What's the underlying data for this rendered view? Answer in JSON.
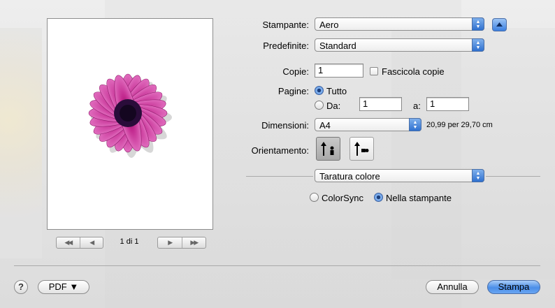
{
  "preview": {
    "page_info": "1 di 1",
    "nav_first": "◀◀",
    "nav_prev": "◀",
    "nav_next": "▶",
    "nav_last": "▶▶"
  },
  "printer": {
    "label": "Stampante:",
    "value": "Aero"
  },
  "presets": {
    "label": "Predefinite:",
    "value": "Standard"
  },
  "copies": {
    "label": "Copie:",
    "value": "1",
    "collate_label": "Fascicola copie"
  },
  "pages": {
    "label": "Pagine:",
    "all_label": "Tutto",
    "from_label": "Da:",
    "from_value": "1",
    "to_label": "a:",
    "to_value": "1"
  },
  "paper_size": {
    "label": "Dimensioni:",
    "value": "A4",
    "size_text": "20,99 per 29,70 cm"
  },
  "orientation": {
    "label": "Orientamento:"
  },
  "panel_select": {
    "value": "Taratura colore"
  },
  "color": {
    "colorsync_label": "ColorSync",
    "in_printer_label": "Nella stampante"
  },
  "footer": {
    "help": "?",
    "pdf_label": "PDF ▼",
    "cancel_label": "Annulla",
    "print_label": "Stampa"
  },
  "colors": {
    "accent": "#3b7fe0",
    "flower": "#c2298f"
  }
}
